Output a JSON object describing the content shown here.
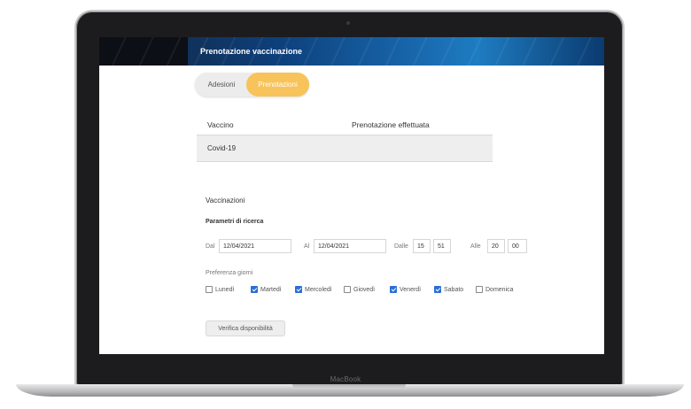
{
  "device": {
    "brand": "MacBook"
  },
  "header": {
    "title": "Prenotazione vaccinazione"
  },
  "tabs": [
    {
      "label": "Adesioni",
      "active": false
    },
    {
      "label": "Prenotazioni",
      "active": true
    }
  ],
  "table": {
    "columns": [
      "Vaccino",
      "Prenotazione effettuata"
    ],
    "rows": [
      [
        "Covid-19",
        ""
      ]
    ]
  },
  "section": {
    "title": "Vaccinazioni",
    "subtitle": "Parametri di ricerca"
  },
  "search": {
    "from_label": "Dal",
    "from_value": "12/04/2021",
    "to_label": "Al",
    "to_value": "12/04/2021",
    "time_from_label": "Dalle",
    "time_from_h": "15",
    "time_from_m": "51",
    "time_to_label": "Alle",
    "time_to_h": "20",
    "time_to_m": "00"
  },
  "days": {
    "label": "Preferenza giorni",
    "items": [
      {
        "label": "Lunedì",
        "checked": false
      },
      {
        "label": "Martedì",
        "checked": true
      },
      {
        "label": "Mercoledì",
        "checked": true
      },
      {
        "label": "Giovedì",
        "checked": false
      },
      {
        "label": "Venerdì",
        "checked": true
      },
      {
        "label": "Sabato",
        "checked": true
      },
      {
        "label": "Domenica",
        "checked": false
      }
    ]
  },
  "actions": {
    "verify_label": "Verifica disponibilità"
  },
  "colors": {
    "accent": "#f7c35a",
    "checkbox": "#2a6fd6",
    "header": "#1763a8"
  }
}
